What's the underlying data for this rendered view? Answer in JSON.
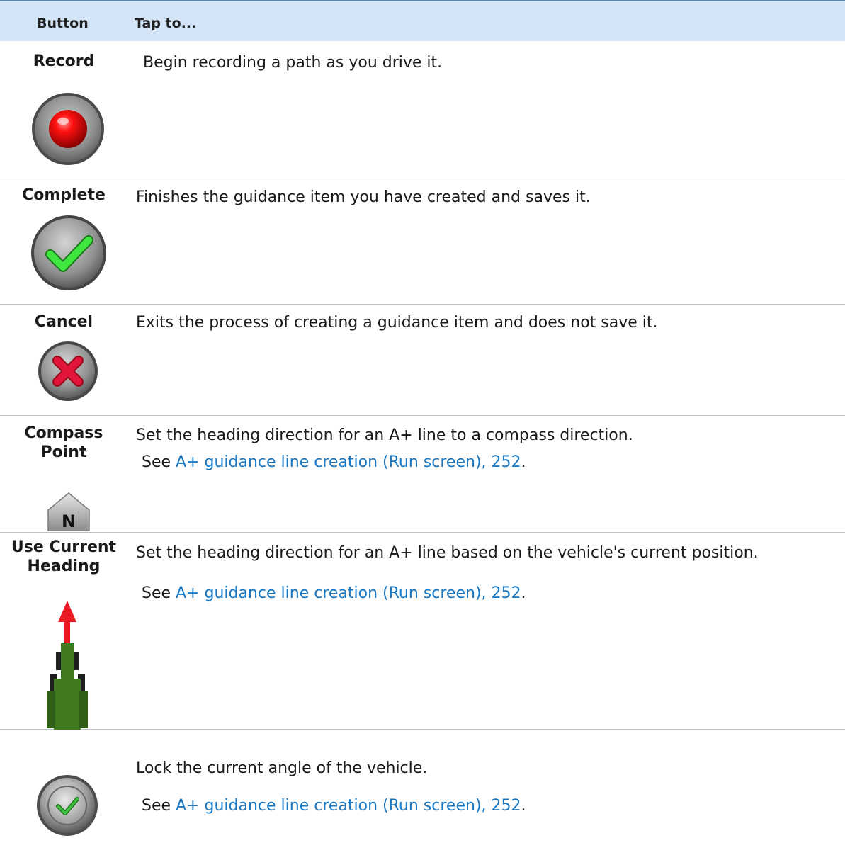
{
  "header": {
    "button": "Button",
    "tap_to": "Tap to..."
  },
  "rows": [
    {
      "name": "Record",
      "description": "Begin recording a path as you drive it.",
      "icon": "record-icon"
    },
    {
      "name": "Complete",
      "description": "Finishes the guidance item you have created and saves it.",
      "icon": "complete-check-icon"
    },
    {
      "name": "Cancel",
      "description": "Exits the process of creating a guidance item and does not save it.",
      "icon": "cancel-x-icon"
    },
    {
      "name_line1": "Compass",
      "name_line2": "Point",
      "description": "Set the heading direction for an A+ line to a compass direction.",
      "see_prefix": "See ",
      "link": "A+ guidance line creation (Run screen), 252",
      "see_suffix": ".",
      "icon": "compass-north-icon"
    },
    {
      "name_line1": "Use Current",
      "name_line2": "Heading",
      "description": "Set the heading direction for an A+ line based on the vehicle's current position.",
      "see_prefix": "See ",
      "link": "A+ guidance line creation (Run screen), 252",
      "see_suffix": ".",
      "icon": "vehicle-heading-icon"
    },
    {
      "name": "",
      "description": "Lock the current angle of the vehicle.",
      "see_prefix": "See ",
      "link": "A+ guidance line creation (Run screen), 252",
      "see_suffix": ".",
      "icon": "lock-angle-icon"
    }
  ],
  "colors": {
    "header_bg": "#d3e4f6",
    "link": "#1a78c2",
    "rule": "#b9c3cc"
  }
}
